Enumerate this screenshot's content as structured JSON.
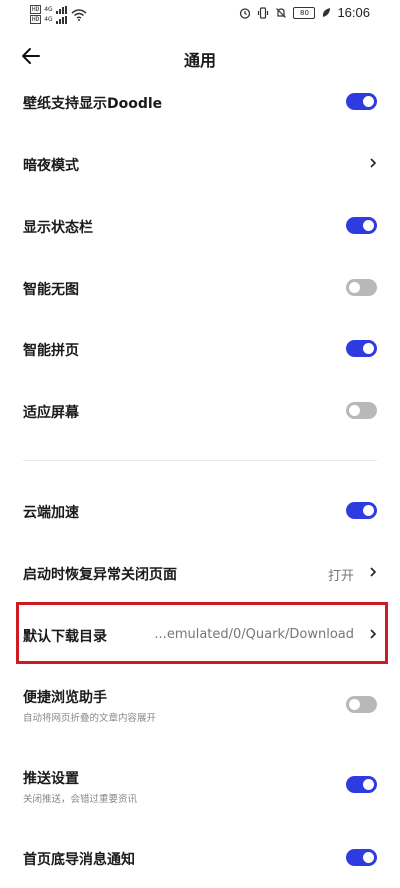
{
  "status_bar": {
    "sim1": "HD",
    "sim2": "HD",
    "net1": "4G",
    "net2": "4G",
    "battery": "80",
    "time": "16:06"
  },
  "header": {
    "title": "通用"
  },
  "settings": {
    "doodle": {
      "label": "壁纸支持显示Doodle",
      "state": "on"
    },
    "dark_mode": {
      "label": "暗夜模式"
    },
    "status_bar": {
      "label": "显示状态栏",
      "state": "on"
    },
    "no_image": {
      "label": "智能无图",
      "state": "off"
    },
    "page_merge": {
      "label": "智能拼页",
      "state": "on"
    },
    "fit_screen": {
      "label": "适应屏幕",
      "state": "off"
    },
    "cloud_accel": {
      "label": "云端加速",
      "state": "on"
    },
    "restore_pages": {
      "label": "启动时恢复异常关闭页面",
      "value": "打开"
    },
    "download_dir": {
      "label": "默认下载目录",
      "value": "...emulated/0/Quark/Download"
    },
    "quick_browse": {
      "label": "便捷浏览助手",
      "sub": "自动将网页折叠的文章内容展开",
      "state": "off"
    },
    "push": {
      "label": "推送设置",
      "sub": "关闭推送，会错过重要资讯",
      "state": "on"
    },
    "bottom_notify": {
      "label": "首页底导消息通知",
      "state": "on"
    }
  },
  "colors": {
    "toggle_on": "#2e3bde",
    "toggle_off": "#b8b8b8",
    "highlight": "#cc1b22"
  }
}
